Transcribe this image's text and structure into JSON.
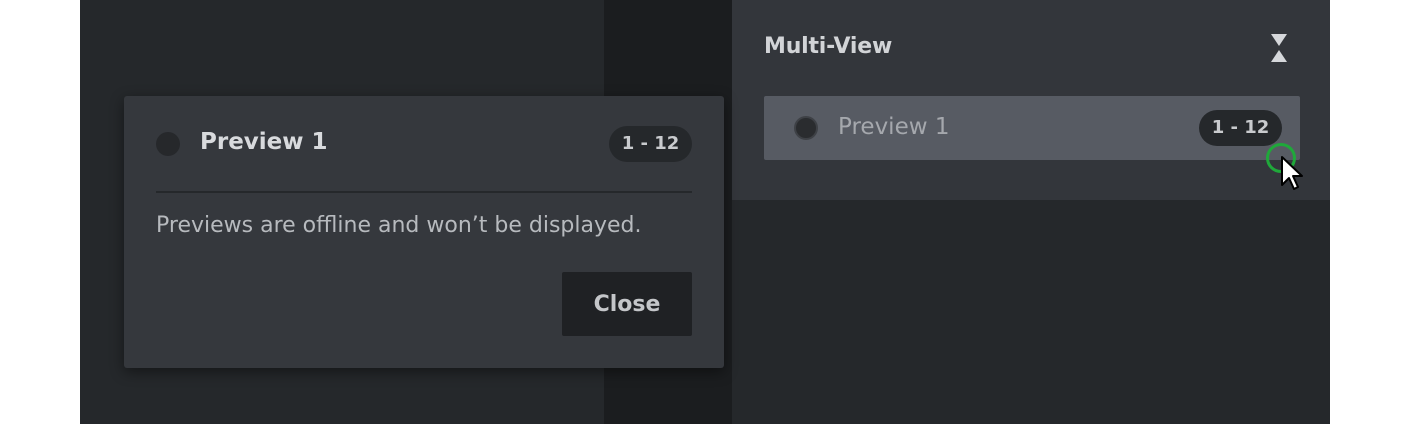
{
  "multiview": {
    "title": "Multi-View",
    "collapse_icon": "collapse-icon",
    "items": [
      {
        "label": "Preview 1",
        "range": "1 - 12",
        "status": "offline"
      }
    ]
  },
  "dialog": {
    "title": "Preview 1",
    "range": "1 - 12",
    "message": "Previews are offline and won’t be displayed.",
    "close_label": "Close"
  },
  "colors": {
    "background": "#25282b",
    "panel": "#33363b",
    "row_selected": "#575b63",
    "dialog": "#35383d",
    "cursor_highlight": "#1fa83a"
  }
}
